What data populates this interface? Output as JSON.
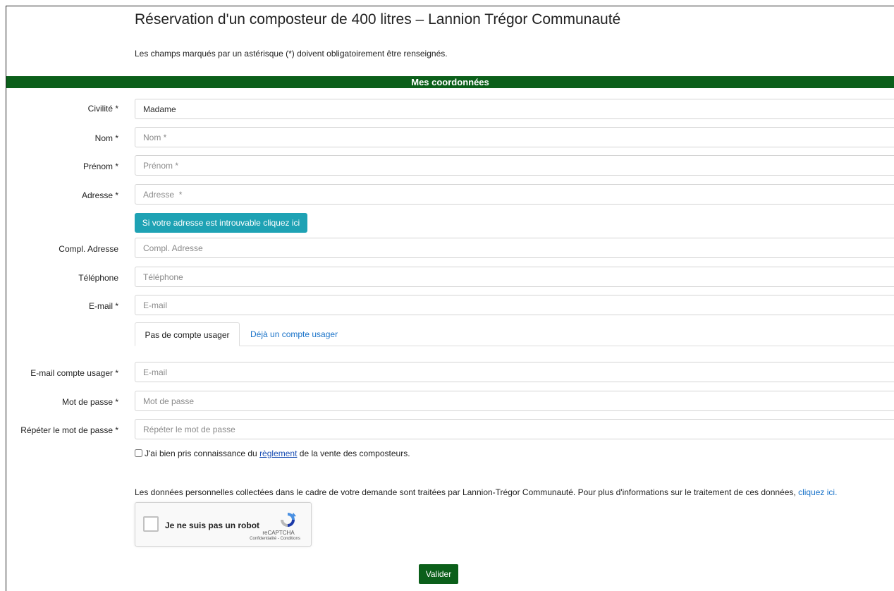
{
  "page": {
    "title": "Réservation d'un composteur de 400 litres – Lannion Trégor Communauté",
    "subtitle": "Les champs marqués par un astérisque (*) doivent obligatoirement être renseignés."
  },
  "section": {
    "title": "Mes coordonnées"
  },
  "fields": {
    "civilite": {
      "label": "Civilité *",
      "value": "Madame"
    },
    "nom": {
      "label": "Nom *",
      "placeholder": "Nom *"
    },
    "prenom": {
      "label": "Prénom *",
      "placeholder": "Prénom *"
    },
    "adresse": {
      "label": "Adresse *",
      "placeholder": "Adresse  *"
    },
    "compl_adresse": {
      "label": "Compl. Adresse",
      "placeholder": "Compl. Adresse"
    },
    "telephone": {
      "label": "Téléphone",
      "placeholder": "Téléphone"
    },
    "email": {
      "label": "E-mail *",
      "placeholder": "E-mail"
    },
    "email_compte": {
      "label": "E-mail compte usager *",
      "placeholder": "E-mail"
    },
    "mot_de_passe": {
      "label": "Mot de passe *",
      "placeholder": "Mot de passe"
    },
    "repeter_mot_de_passe": {
      "label": "Répéter le mot de passe *",
      "placeholder": "Répéter le mot de passe"
    }
  },
  "address_button": {
    "label": "Si votre adresse est introuvable cliquez ici"
  },
  "tabs": [
    {
      "label": "Pas de compte usager",
      "active": true
    },
    {
      "label": "Déjà un compte usager",
      "active": false
    }
  ],
  "reglement": {
    "before": "J'ai bien pris connaissance du ",
    "link": "règlement",
    "after": " de la vente des composteurs."
  },
  "privacy": {
    "text": "Les données personnelles collectées dans le cadre de votre demande sont traitées par Lannion-Trégor Communauté. Pour plus d'informations sur le traitement de ces données, ",
    "link": "cliquez ici."
  },
  "recaptcha": {
    "label": "Je ne suis pas un robot",
    "brand": "reCAPTCHA",
    "terms": "Confidentialité - Conditions"
  },
  "submit": {
    "label": "Valider"
  },
  "colors": {
    "section_green": "#0b5f1a",
    "button_teal": "#1ea2b4",
    "link_blue": "#1a73c9"
  },
  "icons": {
    "recaptcha_logo": "recaptcha-logo-icon"
  }
}
